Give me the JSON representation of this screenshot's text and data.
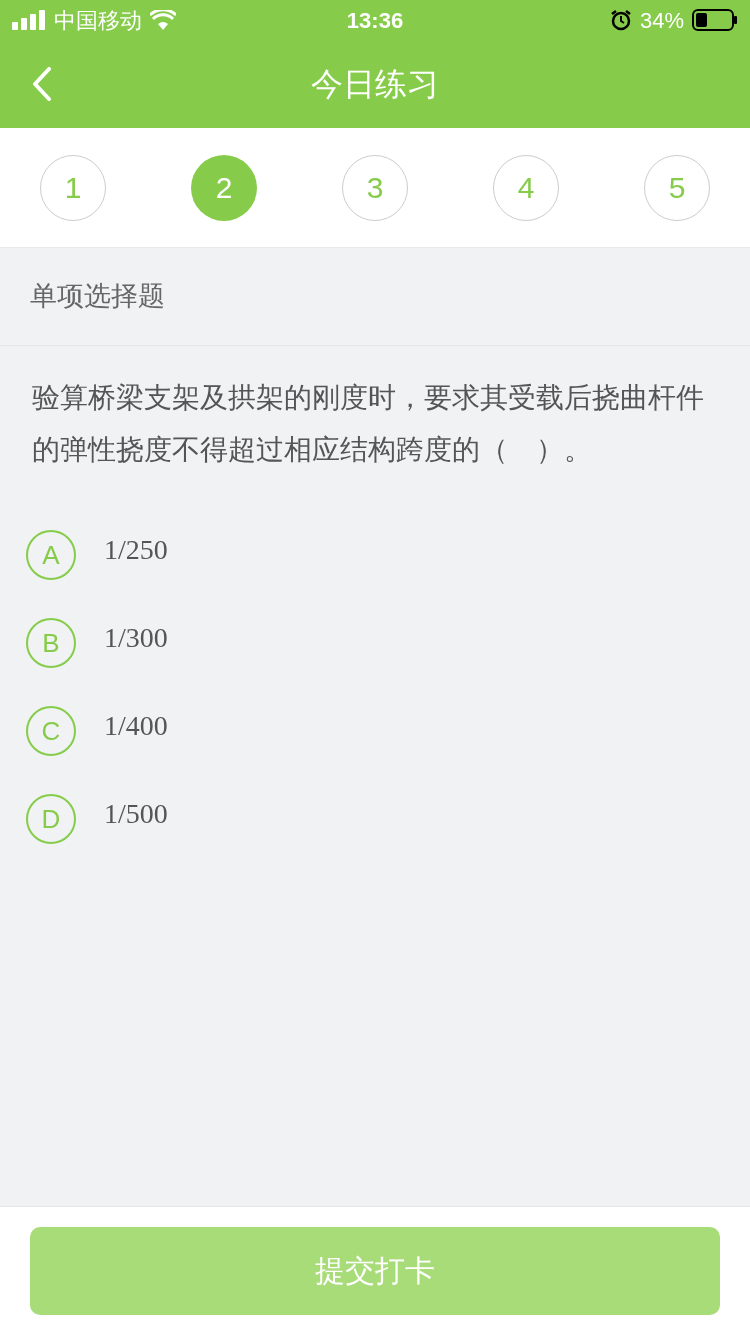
{
  "status_bar": {
    "carrier": "中国移动",
    "time": "13:36",
    "battery": "34%"
  },
  "nav": {
    "title": "今日练习"
  },
  "steps": [
    {
      "label": "1",
      "selected": false
    },
    {
      "label": "2",
      "selected": true
    },
    {
      "label": "3",
      "selected": false
    },
    {
      "label": "4",
      "selected": false
    },
    {
      "label": "5",
      "selected": false
    }
  ],
  "question": {
    "type_label": "单项选择题",
    "text": "验算桥梁支架及拱架的刚度时，要求其受载后挠曲杆件的弹性挠度不得超过相应结构跨度的（　）。",
    "options": [
      {
        "letter": "A",
        "text": "1/250",
        "selected": false
      },
      {
        "letter": "B",
        "text": "1/300",
        "selected": false
      },
      {
        "letter": "C",
        "text": "1/400",
        "selected": false
      },
      {
        "letter": "D",
        "text": "1/500",
        "selected": false
      }
    ]
  },
  "submit_button": "提交打卡"
}
